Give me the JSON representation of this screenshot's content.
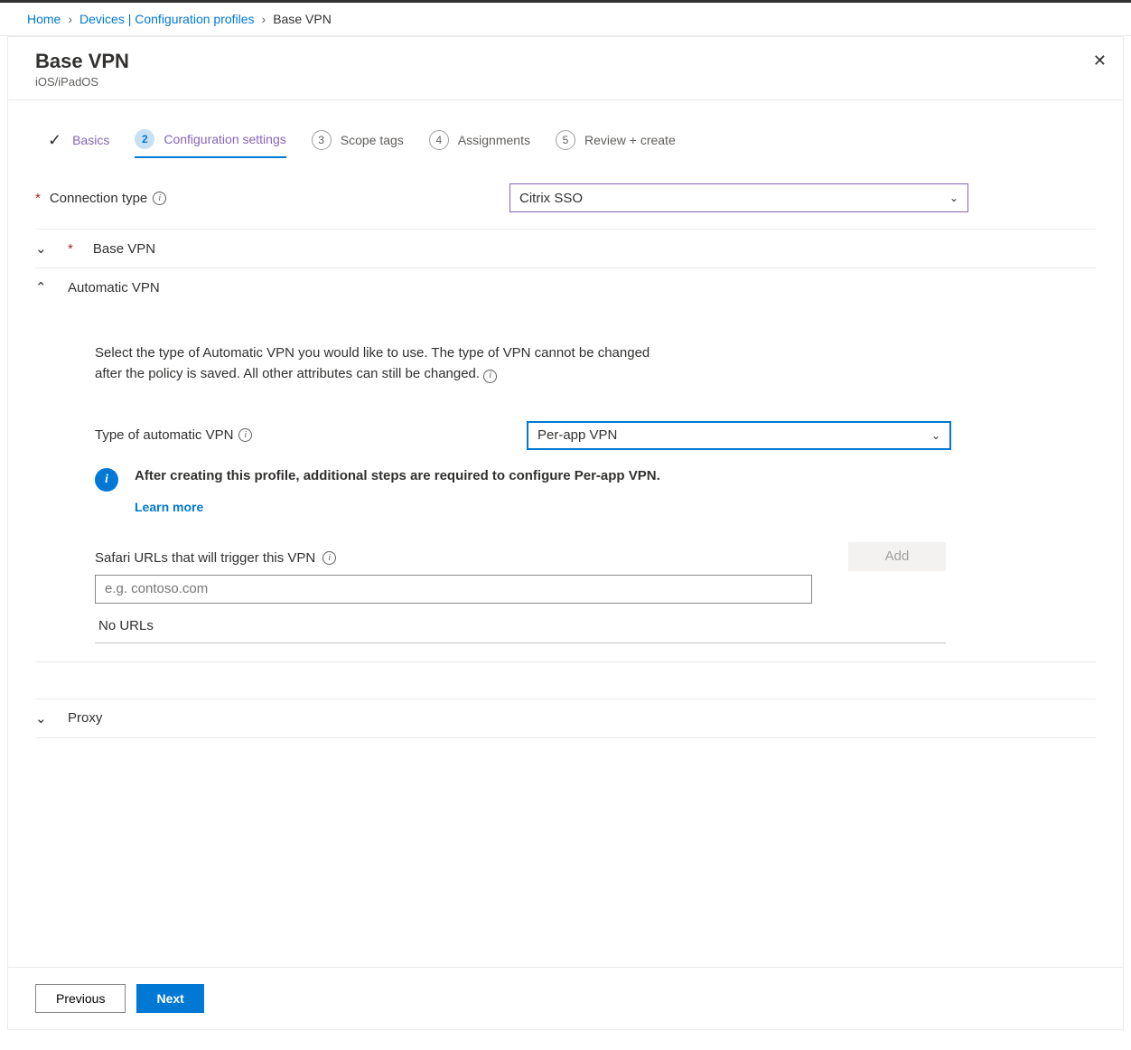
{
  "breadcrumb": {
    "home": "Home",
    "devices": "Devices | Configuration profiles",
    "current": "Base VPN"
  },
  "header": {
    "title": "Base VPN",
    "subtitle": "iOS/iPadOS"
  },
  "tabs": {
    "basics": "Basics",
    "config": "Configuration settings",
    "scope": "Scope tags",
    "assign": "Assignments",
    "review": "Review + create",
    "n2": "2",
    "n3": "3",
    "n4": "4",
    "n5": "5"
  },
  "fields": {
    "conn_label": "Connection type",
    "conn_value": "Citrix SSO",
    "base_vpn": "Base VPN",
    "auto_vpn": "Automatic VPN",
    "auto_desc": "Select the type of Automatic VPN you would like to use. The type of VPN cannot be changed after the policy is saved. All other attributes can still be changed.",
    "type_label": "Type of automatic VPN",
    "type_value": "Per-app VPN",
    "info_text": "After creating this profile, additional steps are required to configure Per-app VPN.",
    "learn": "Learn more",
    "safari_label": "Safari URLs that will trigger this VPN",
    "safari_placeholder": "e.g. contoso.com",
    "add": "Add",
    "nourls": "No URLs",
    "proxy": "Proxy"
  },
  "footer": {
    "prev": "Previous",
    "next": "Next"
  }
}
